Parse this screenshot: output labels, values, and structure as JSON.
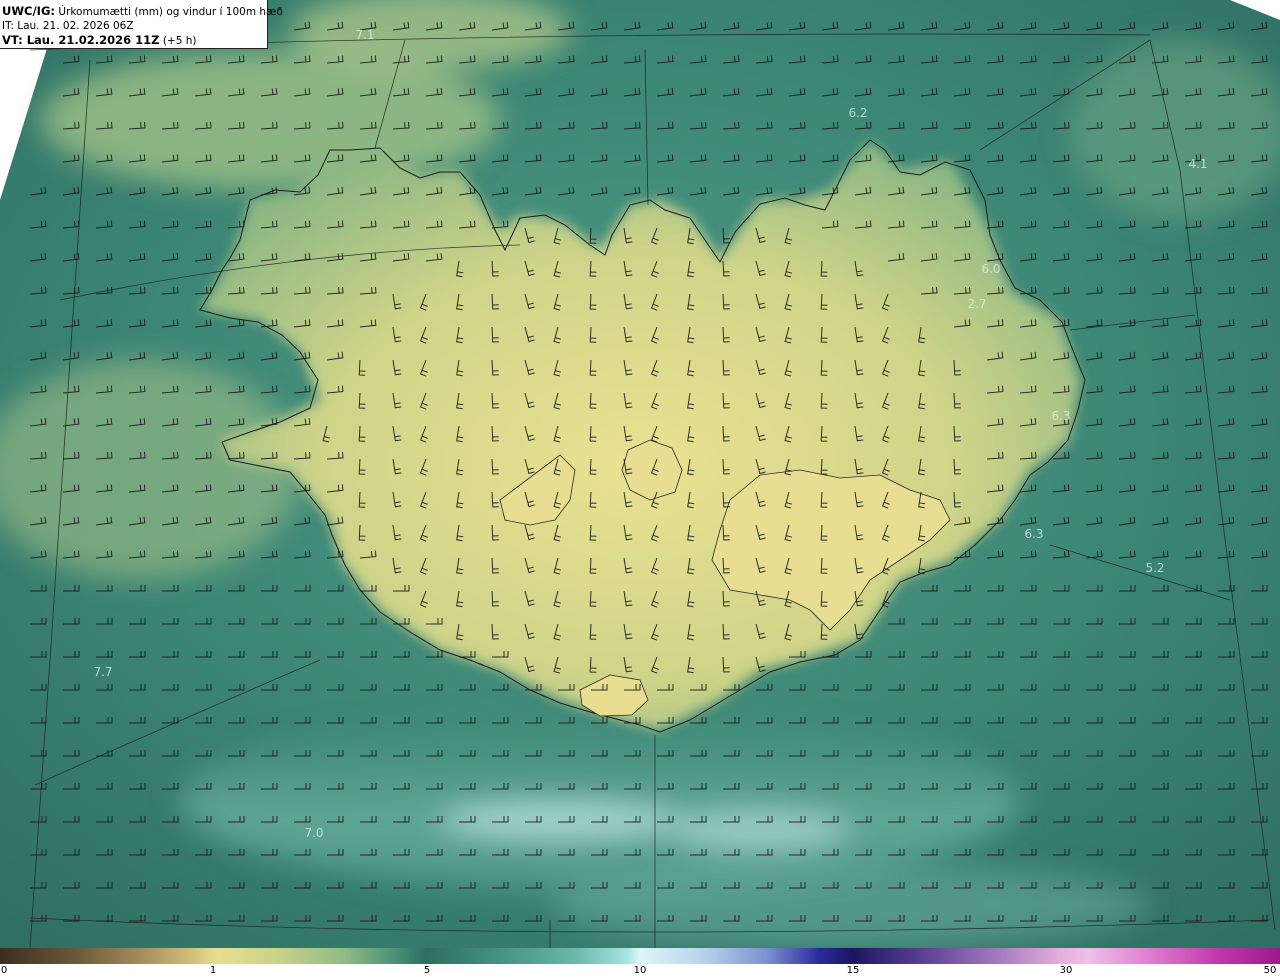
{
  "header": {
    "product": "UWC/IG:",
    "title": "Úrkomumætti (mm) og vindur í 100m hæð",
    "init_time": "IT: Lau. 21. 02. 2026 06Z",
    "valid_prefix": "VT: Lau. 21.02.2026 11Z",
    "valid_suffix": "(+5 h)"
  },
  "colorbar": {
    "ticks": [
      "0",
      "1",
      "5",
      "10",
      "15",
      "30",
      "50"
    ]
  },
  "contour_labels": [
    "7.1",
    "6.2",
    "4.1",
    "6.0",
    "2.7",
    "6.3",
    "6.3",
    "5.2",
    "7.7",
    "7.0"
  ],
  "colors": {
    "sea_dark": "#2f6e62",
    "sea_light": "#8fcab9",
    "land_yellow": "#e7e08e",
    "coast": "#1c1c1c",
    "wind_barb": "#1a1a1a"
  },
  "icons": {
    "wind_barb": "wind-barb-icon"
  }
}
